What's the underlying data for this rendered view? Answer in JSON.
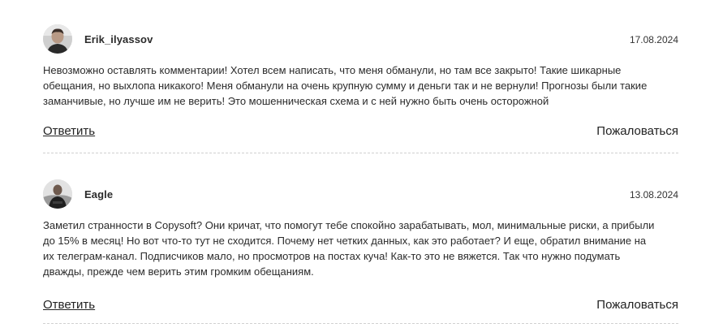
{
  "comments": [
    {
      "author": "Erik_ilyassov",
      "date": "17.08.2024",
      "text": "Невозможно оставлять комментарии! Хотел всем написать, что меня обманули, но там все закрыто! Такие шикарные обещания, но выхлопа никакого! Меня обманули на очень крупную сумму и деньги так и не вернули! Прогнозы были такие заманчивые, но лучше им не верить! Это мошенническая схема и с ней нужно быть очень осторожной",
      "reply_label": "Ответить",
      "report_label": "Пожаловаться"
    },
    {
      "author": "Eagle",
      "date": "13.08.2024",
      "text": "Заметил странности в Copysoft? Они кричат, что помогут тебе спокойно зарабатывать, мол, минимальные риски, а прибыли до 15% в месяц! Но вот что-то тут не сходится. Почему нет четких данных, как это работает? И еще, обратил внимание на их телеграм-канал. Подписчиков мало, но просмотров на постах куча! Как-то это не вяжется. Так что нужно подумать дважды, прежде чем верить этим громким обещаниям.",
      "reply_label": "Ответить",
      "report_label": "Пожаловаться"
    }
  ],
  "colors": {
    "text": "#222222",
    "divider": "#d0d0d0",
    "background": "#ffffff"
  },
  "icons": {
    "avatar_1": "user-photo-avatar",
    "avatar_2": "user-photo-avatar"
  }
}
